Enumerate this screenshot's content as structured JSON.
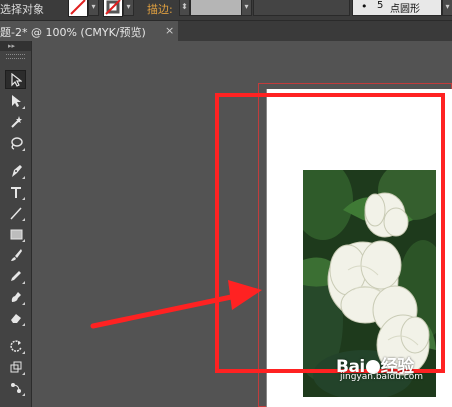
{
  "control_bar": {
    "selection_label": "选择对象",
    "stroke_label": "描边:",
    "shape_dot": "•",
    "brush_size": "5",
    "brush_shape": "点圆形"
  },
  "document_tab": {
    "title": "题-2* @ 100% (CMYK/预览)",
    "close": "×"
  },
  "toolbox": {
    "collapse": "▸▸",
    "tools": [
      "selection-tool",
      "direct-selection-tool",
      "magic-wand-tool",
      "lasso-tool",
      "pen-tool",
      "type-tool",
      "line-segment-tool",
      "rectangle-tool",
      "paintbrush-tool",
      "pencil-tool",
      "blob-brush-tool",
      "eraser-tool",
      "rotate-tool",
      "scale-tool",
      "puppet-warp-tool"
    ]
  },
  "colors": {
    "annotation": "#ff2222",
    "workspace": "#535353",
    "toolbar": "#434343",
    "artboard_outline": "#c13c3c"
  },
  "watermark": {
    "logo_left": "Bai",
    "logo_right": "经验",
    "url": "jingyan.baidu.com"
  }
}
